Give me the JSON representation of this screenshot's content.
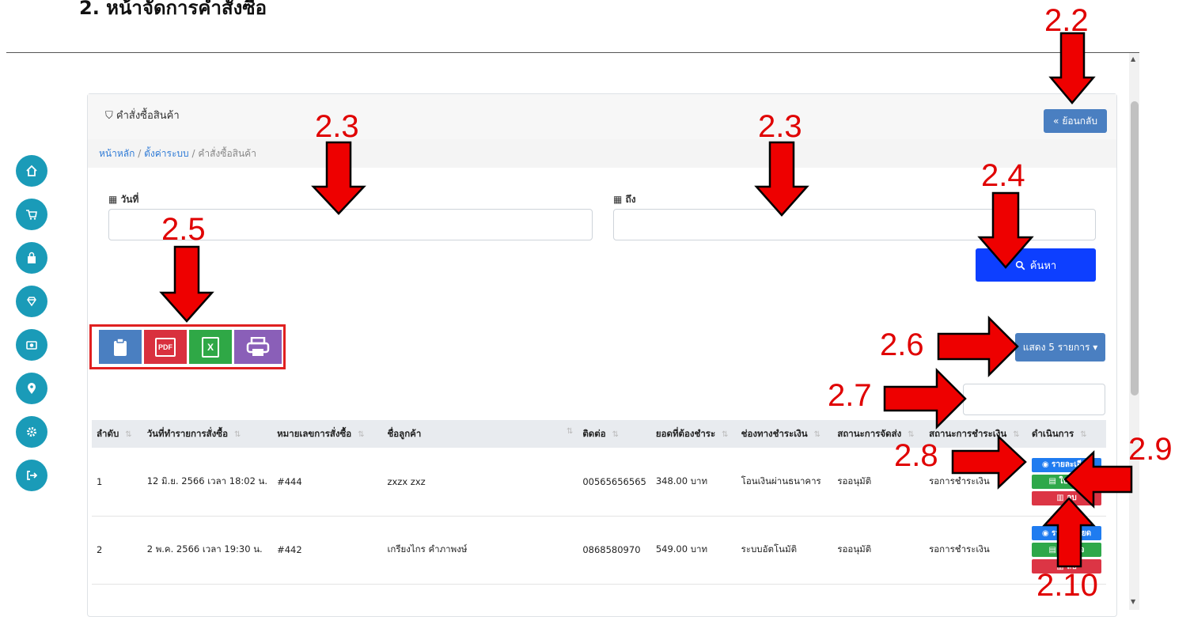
{
  "doc_heading": "2. หน้าจัดการคำสั่งซื้อ",
  "card": {
    "title": "คำสั่งซื้อสินค้า",
    "back_label": "ย้อนกลับ"
  },
  "breadcrumb": {
    "home": "หน้าหลัก",
    "settings": "ตั้งค่าระบบ",
    "current": "คำสั่งซื้อสินค้า",
    "sep": "/"
  },
  "filters": {
    "from_label": "วันที่",
    "to_label": "ถึง",
    "from_value": "",
    "to_value": "",
    "search_label": "ค้นหา"
  },
  "export": {
    "pdf_text": "PDF",
    "excel_text": "X"
  },
  "page_size_label": "แสดง 5 รายการ",
  "table": {
    "headers": [
      "ลำดับ",
      "วันที่ทำรายการสั่งซื้อ",
      "หมายเลขการสั่งซื้อ",
      "ชื่อลูกค้า",
      "ติดต่อ",
      "ยอดที่ต้องชำระ",
      "ช่องทางชำระเงิน",
      "สถานะการจัดส่ง",
      "สถานะการชำระเงิน",
      "ดำเนินการ"
    ],
    "rows": [
      [
        "1",
        "12 มิ.ย. 2566 เวลา 18:02 น.",
        "#444",
        "zxzx zxz",
        "00565656565",
        "348.00 บาท",
        "โอนเงินผ่านธนาคาร",
        "รออนุมัติ",
        "รอการชำระเงิน"
      ],
      [
        "2",
        "2 พ.ค. 2566 เวลา 19:30 น.",
        "#442",
        "เกรียงไกร คำภาพงษ์",
        "0868580970",
        "549.00 บาท",
        "ระบบอัตโนมัติ",
        "รออนุมัติ",
        "รอการชำระเงิน"
      ]
    ],
    "actions": {
      "detail": "รายละเอียด",
      "receipt": "ใบเสร็จ",
      "delete": "ลบ"
    }
  },
  "annotations": [
    "2.2",
    "2.3",
    "2.3",
    "2.4",
    "2.5",
    "2.6",
    "2.7",
    "2.8",
    "2.9",
    "2.10"
  ],
  "colors": {
    "sidebar": "#1a9bb8",
    "primary": "#4a7fc1",
    "search": "#0d3fff",
    "annotation": "#e00000"
  },
  "sidebar_icons": [
    "home-icon",
    "cart-icon",
    "bag-icon",
    "diamond-icon",
    "camera-icon",
    "location-icon",
    "gear-icon",
    "logout-icon"
  ]
}
